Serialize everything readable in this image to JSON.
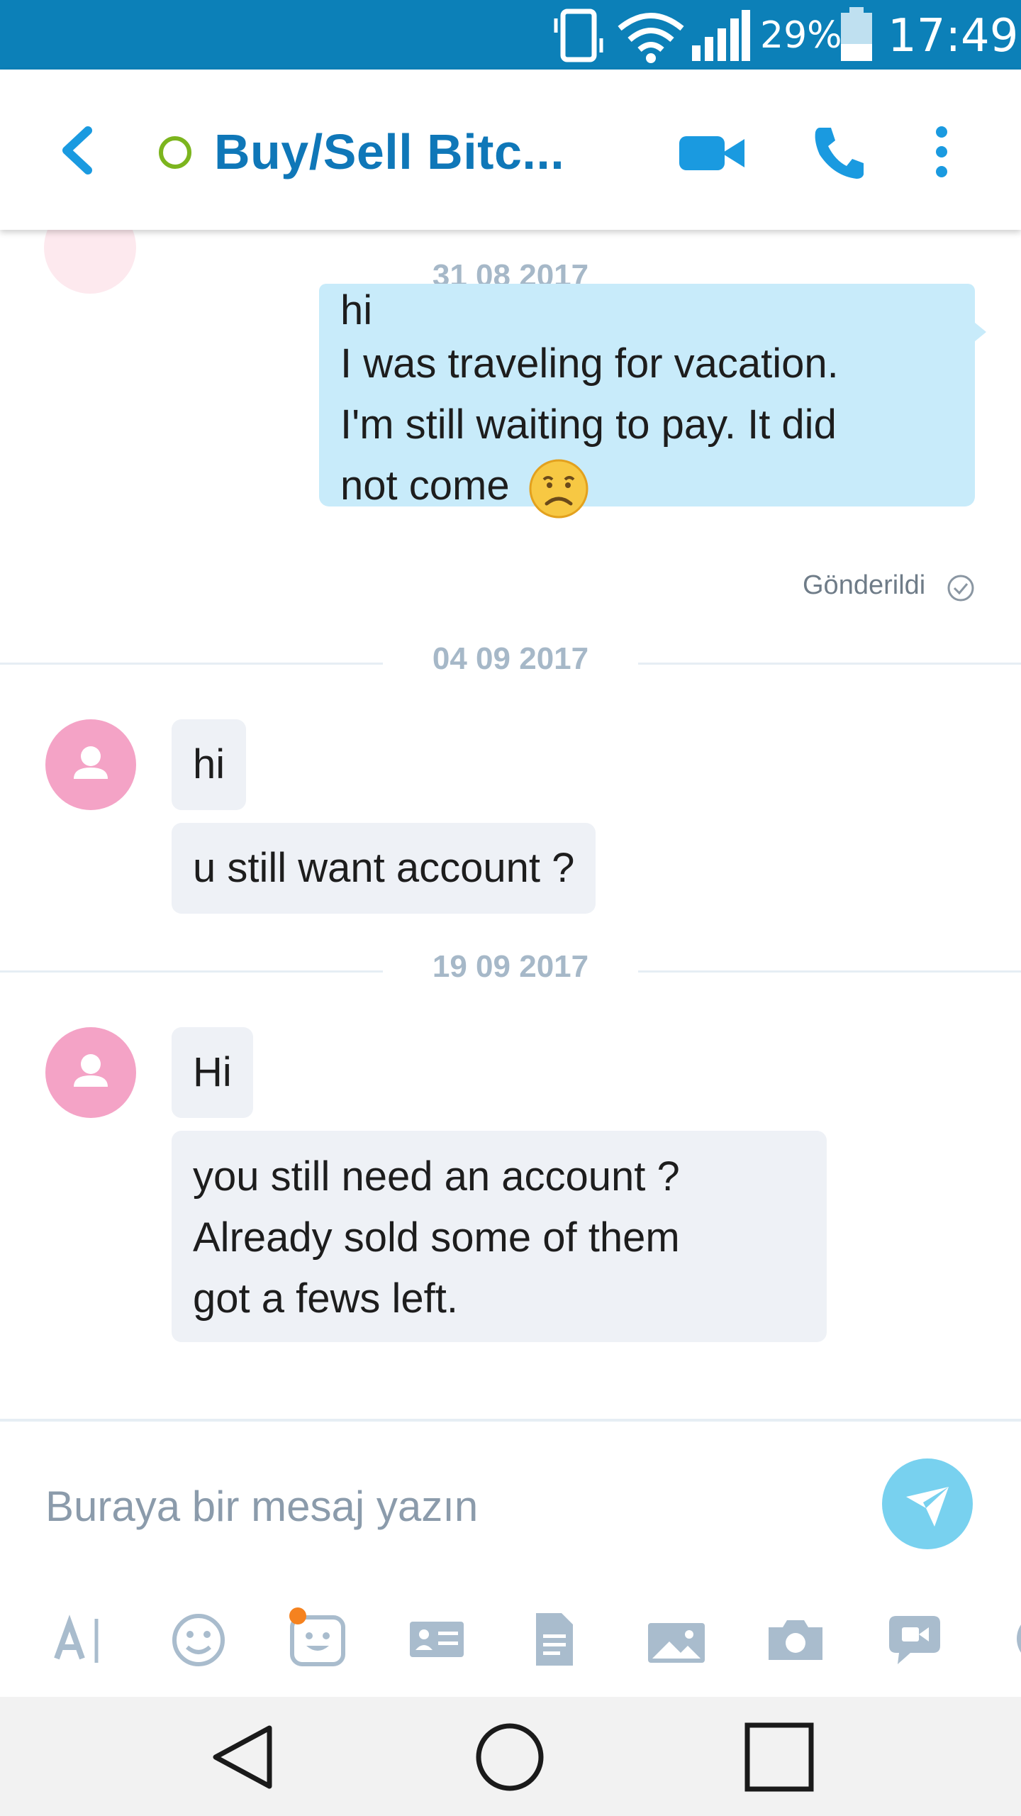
{
  "status_bar": {
    "battery_percent": "29%",
    "time": "17:49",
    "icons": [
      "vibrate-icon",
      "wifi-icon",
      "signal-icon",
      "battery-icon"
    ]
  },
  "header": {
    "title": "Buy/Sell Bitc...",
    "presence": "offline",
    "actions": [
      "back-icon",
      "video-call-icon",
      "phone-icon",
      "more-options-icon"
    ],
    "accent_color": "#0f77b8"
  },
  "conversation": {
    "groups": [
      {
        "date": "31 08 2017",
        "messages": [
          {
            "direction": "outgoing",
            "lines": [
              "hi",
              "I was traveling for vacation.",
              "I'm still waiting to pay. It did",
              "not come"
            ],
            "emoji": "weary-face-icon",
            "status": "Gönderildi"
          }
        ]
      },
      {
        "date": "04 09 2017",
        "messages": [
          {
            "direction": "incoming",
            "lines": [
              "hi"
            ]
          },
          {
            "direction": "incoming",
            "lines": [
              "u still want account ?"
            ]
          }
        ]
      },
      {
        "date": "19 09 2017",
        "messages": [
          {
            "direction": "incoming",
            "lines": [
              "Hi"
            ]
          },
          {
            "direction": "incoming",
            "lines": [
              "you still need an account ?",
              "Already sold some of them",
              "got a fews left."
            ]
          }
        ]
      }
    ]
  },
  "composer": {
    "placeholder": "Buraya bir mesaj yazın",
    "send_icon": "send-icon"
  },
  "toolbar": {
    "items": [
      "text-format-icon",
      "emoticon-icon",
      "moji-icon",
      "contact-card-icon",
      "file-icon",
      "media-gallery-icon",
      "camera-icon",
      "video-message-icon"
    ]
  },
  "nav_bar": {
    "items": [
      "back-nav-icon",
      "home-nav-icon",
      "recents-nav-icon"
    ]
  },
  "colors": {
    "status_bar": "#0c80b8",
    "outgoing_bubble": "#c8ebfa",
    "incoming_bubble": "#eef1f6",
    "avatar": "#f4a3c6",
    "send_button": "#78d1ef"
  }
}
